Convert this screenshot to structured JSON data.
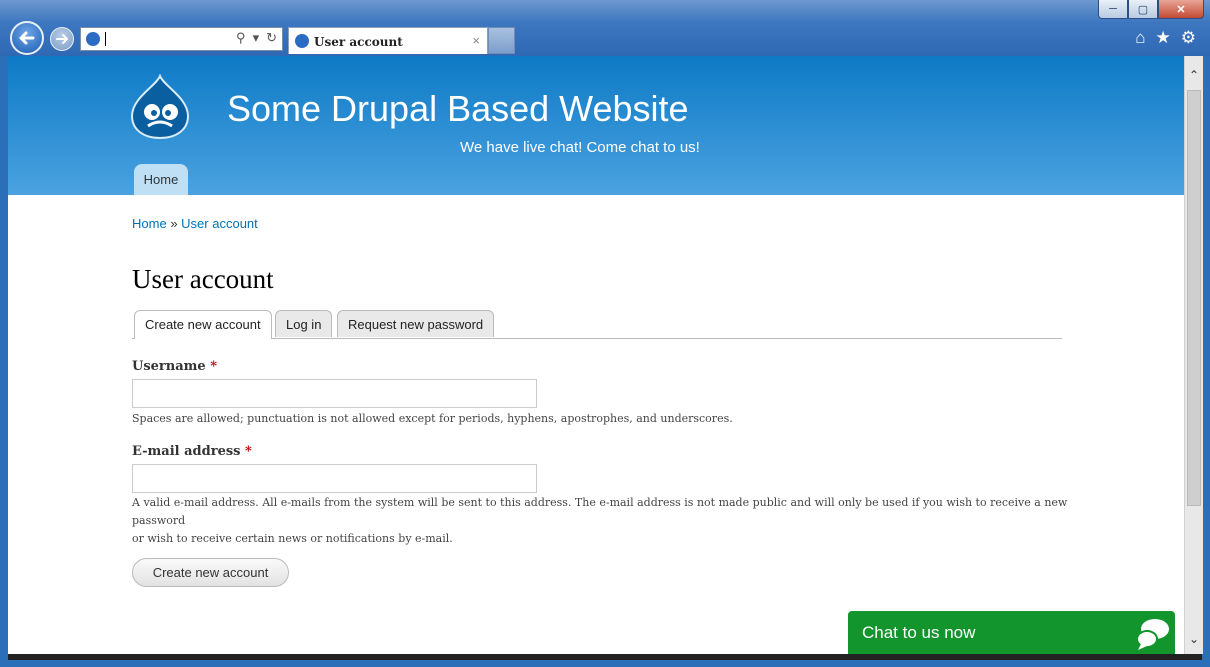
{
  "browser": {
    "tab_title": "User account",
    "address_value": "",
    "tab_close": "×",
    "toolbar_icons": [
      "home-icon",
      "star-icon",
      "gear-icon"
    ]
  },
  "site": {
    "name": "Some Drupal Based Website",
    "slogan": "We have live chat! Come chat to us!",
    "nav_home": "Home"
  },
  "breadcrumb": {
    "home": "Home",
    "separator": "»",
    "current": "User account"
  },
  "page": {
    "title": "User account",
    "tabs": [
      "Create new account",
      "Log in",
      "Request new password"
    ]
  },
  "form": {
    "username_label": "Username",
    "username_help": "Spaces are allowed; punctuation is not allowed except for periods, hyphens, apostrophes, and underscores.",
    "email_label": "E-mail address",
    "email_help_1": "A valid e-mail address. All e-mails from the system will be sent to this address. The e-mail address is not made public and will only be used if you wish to receive a new password",
    "email_help_2": "or wish to receive certain news or notifications by e-mail.",
    "required_marker": "*",
    "submit_label": "Create new account"
  },
  "chat": {
    "label": "Chat to us now"
  },
  "colors": {
    "header_top": "#0d7ac6",
    "header_bottom": "#4ba2e0",
    "link": "#0071b3",
    "chat": "#13952e",
    "required": "#cc0000"
  }
}
